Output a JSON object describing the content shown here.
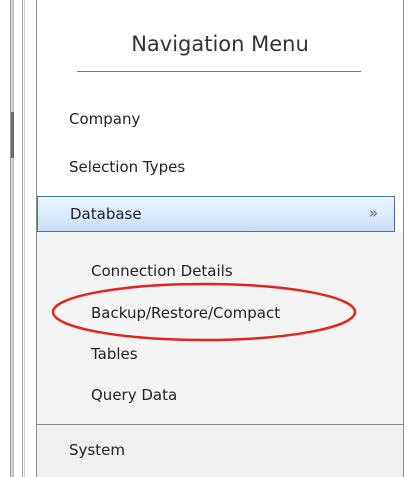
{
  "nav": {
    "title": "Navigation Menu",
    "items": [
      {
        "label": "Company"
      },
      {
        "label": "Selection Types"
      },
      {
        "label": "System"
      }
    ],
    "database": {
      "label": "Database",
      "expanded": true,
      "chevron_icon": "double-chevron-down-icon",
      "header_colors": [
        "#eef5ff",
        "#c9def7"
      ],
      "border_color": "#4b6fa8",
      "subitems": [
        {
          "label": "Connection Details"
        },
        {
          "label": "Backup/Restore/Compact"
        },
        {
          "label": "Tables"
        },
        {
          "label": "Query Data"
        }
      ]
    }
  },
  "annotation": {
    "shape": "ellipse",
    "color": "#e0261c",
    "target": "Backup/Restore/Compact"
  }
}
